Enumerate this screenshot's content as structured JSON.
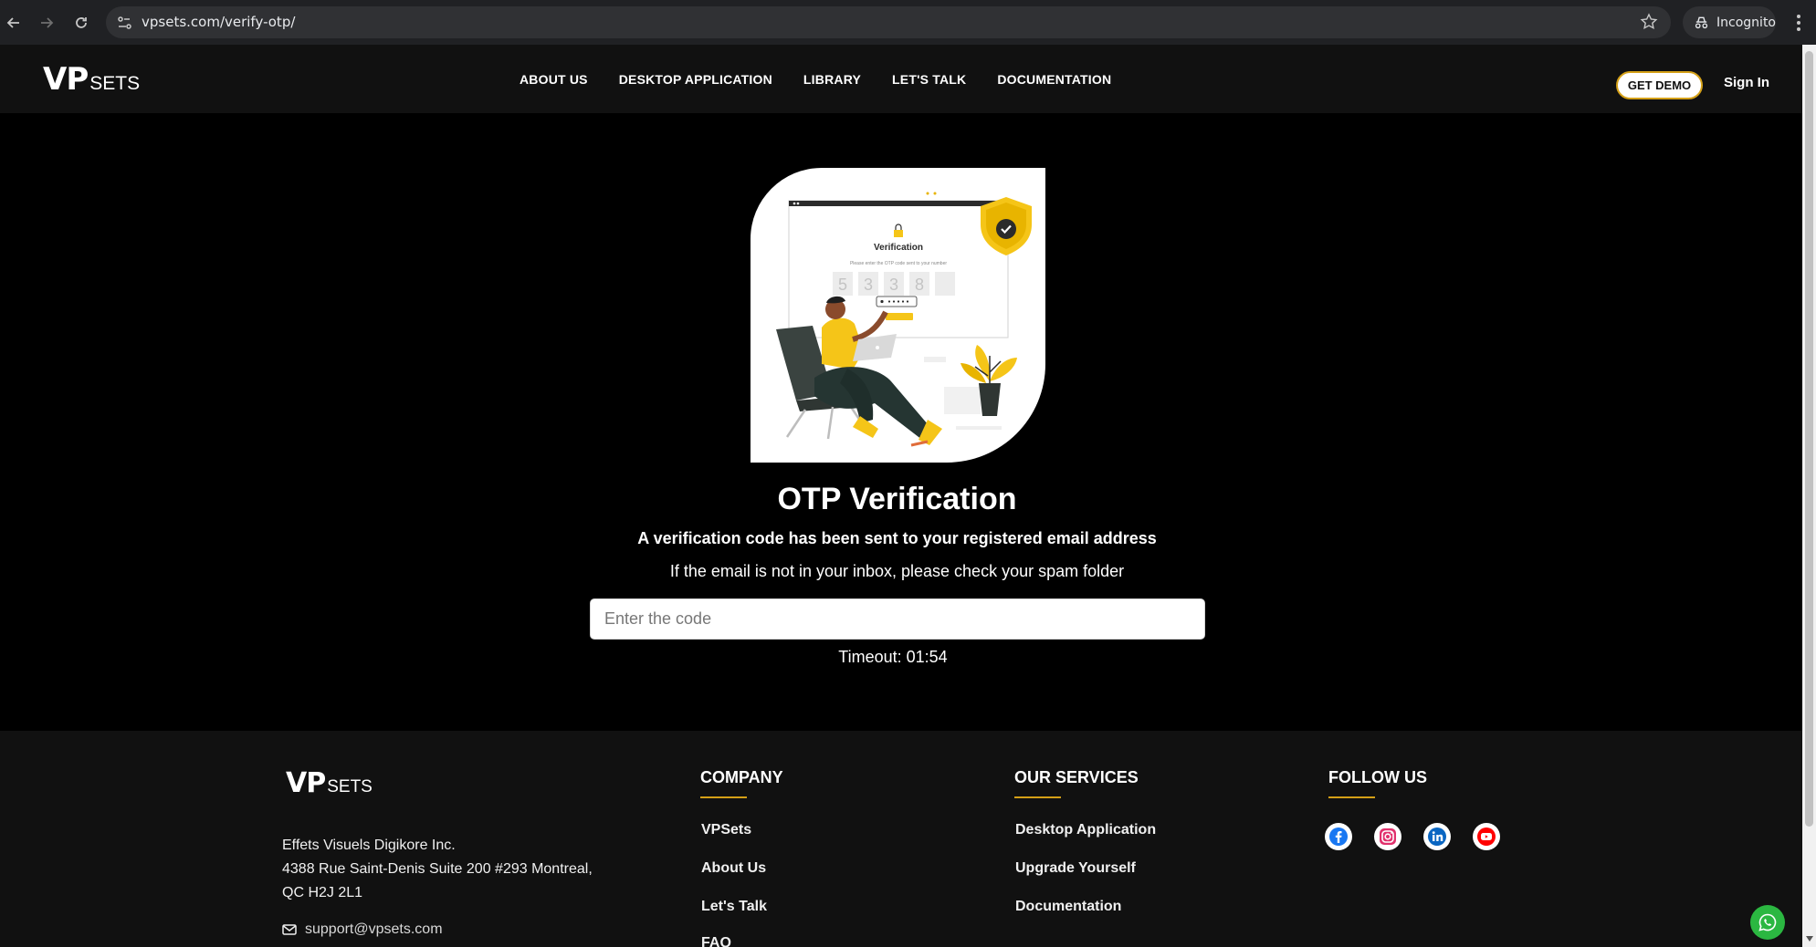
{
  "browser": {
    "url": "vpsets.com/verify-otp/",
    "incognito_label": "Incognito"
  },
  "header": {
    "logo_vp": "VP",
    "logo_sets": "SETS",
    "nav": [
      {
        "label": "ABOUT US"
      },
      {
        "label": "DESKTOP APPLICATION"
      },
      {
        "label": "LIBRARY"
      },
      {
        "label": "LET'S TALK"
      },
      {
        "label": "DOCUMENTATION"
      }
    ],
    "demo_label": "GET DEMO",
    "signin_label": "Sign In"
  },
  "illustration": {
    "card_title": "Verification",
    "card_hint": "Please enter the OTP code sent to your number",
    "digits": [
      "5",
      "3",
      "3",
      "8",
      ""
    ]
  },
  "main": {
    "title": "OTP Verification",
    "subtitle": "A verification code has been sent to your registered email address",
    "note": "If the email is not in your inbox, please check your spam folder",
    "input_placeholder": "Enter the code",
    "timeout": "Timeout: 01:54"
  },
  "footer": {
    "logo_vp": "VP",
    "logo_sets": "SETS",
    "address_line1": "Effets Visuels Digikore Inc.",
    "address_line2": "4388 Rue Saint-Denis Suite 200 #293 Montreal,",
    "address_line3": "QC H2J 2L1",
    "email": "support@vpsets.com",
    "company": {
      "title": "COMPANY",
      "links": [
        "VPSets",
        "About Us",
        "Let's Talk",
        "FAQ"
      ]
    },
    "services": {
      "title": "OUR SERVICES",
      "links": [
        "Desktop Application",
        "Upgrade Yourself",
        "Documentation"
      ]
    },
    "follow": {
      "title": "FOLLOW US"
    }
  },
  "colors": {
    "accent": "#d4a017",
    "whatsapp": "#2bb741",
    "facebook": "#1877f2",
    "instagram": "#e1306c",
    "linkedin": "#0a66c2",
    "youtube": "#ff0000"
  }
}
